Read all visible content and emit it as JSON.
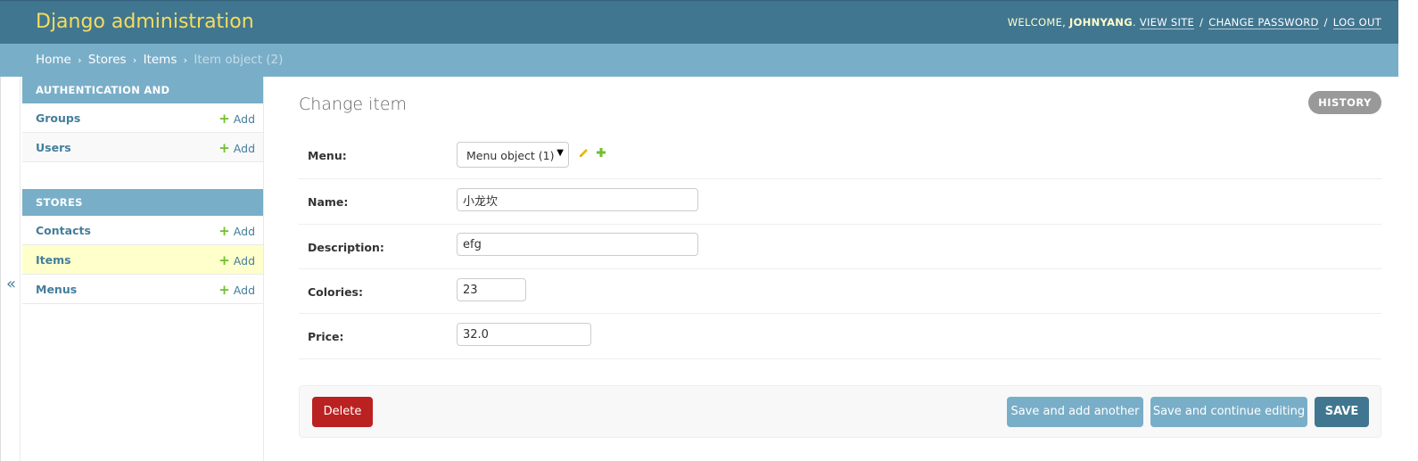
{
  "header": {
    "brand": "Django administration",
    "welcome_prefix": "WELCOME, ",
    "username": "JOHNYANG",
    "view_site": "VIEW SITE",
    "change_password": "CHANGE PASSWORD",
    "log_out": "LOG OUT",
    "separator": "/"
  },
  "breadcrumbs": {
    "home": "Home",
    "app": "Stores",
    "model": "Items",
    "current": "Item object (2)",
    "sep": "›"
  },
  "sidebar": {
    "toggle_icon": "«",
    "modules": [
      {
        "caption": "AUTHENTICATION AND AUTHORIZATION",
        "models": [
          {
            "name": "Groups",
            "add": "Add"
          },
          {
            "name": "Users",
            "add": "Add"
          }
        ]
      },
      {
        "caption": "STORES",
        "models": [
          {
            "name": "Contacts",
            "add": "Add"
          },
          {
            "name": "Items",
            "add": "Add",
            "current": true
          },
          {
            "name": "Menus",
            "add": "Add"
          }
        ]
      }
    ],
    "plus_icon": "+"
  },
  "content": {
    "title": "Change item",
    "history": "HISTORY",
    "fields": {
      "menu": {
        "label": "Menu:",
        "value": "Menu object (1)"
      },
      "name": {
        "label": "Name:",
        "value": "小龙坎"
      },
      "description": {
        "label": "Description:",
        "value": "efg"
      },
      "colories": {
        "label": "Colories:",
        "value": "23"
      },
      "price": {
        "label": "Price:",
        "value": "32.0"
      }
    },
    "icons": {
      "dropdown_arrow": "▼",
      "edit_related": "pencil-icon",
      "add_related": "plus-icon"
    }
  },
  "submit_row": {
    "delete": "Delete",
    "save_add_another": "Save and add another",
    "save_continue": "Save and continue editing",
    "save": "SAVE"
  },
  "colors": {
    "header_bg": "#417690",
    "brand": "#f5dd5d",
    "breadcrumbs_bg": "#79aec8",
    "link": "#447e9b",
    "add_green": "#70bf2b",
    "delete_red": "#ba2121",
    "current_row": "#ffffcc"
  }
}
